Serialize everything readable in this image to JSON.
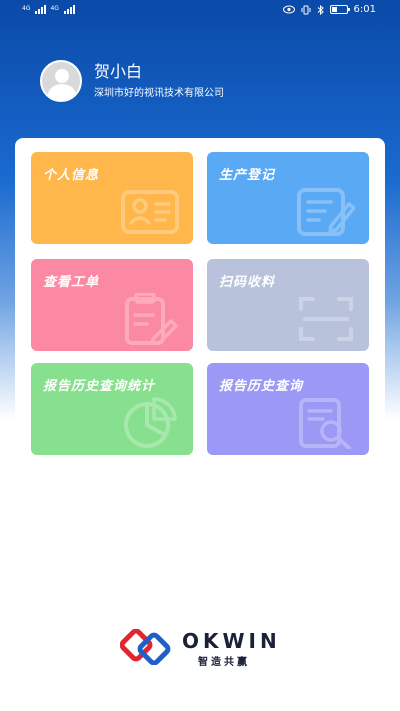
{
  "status_bar": {
    "sim1_label": "4G",
    "sim2_label": "4G",
    "time": "6:01",
    "battery_icon": "battery-icon",
    "eye_icon": "eye-icon",
    "vibrate_icon": "vibrate-icon",
    "bluetooth_icon": "bluetooth-icon"
  },
  "user": {
    "name": "贺小白",
    "company": "深圳市好的视讯技术有限公司",
    "avatar_icon": "avatar-icon"
  },
  "tiles": [
    {
      "label": "个人信息",
      "color": "#ffb64a",
      "icon": "id-card-icon"
    },
    {
      "label": "生产登记",
      "color": "#5aa9f5",
      "icon": "edit-form-icon"
    },
    {
      "label": "查看工单",
      "color": "#fb89a3",
      "icon": "clipboard-icon"
    },
    {
      "label": "扫码收料",
      "color": "#b8c2da",
      "icon": "scan-icon"
    },
    {
      "label": "报告历史查询统计",
      "color": "#86e08e",
      "icon": "pie-chart-icon"
    },
    {
      "label": "报告历史查询",
      "color": "#9b98f6",
      "icon": "search-document-icon"
    }
  ],
  "footer": {
    "brand": "OKWIN",
    "slogan": "智造共赢",
    "logo_colors": [
      "#e0262f",
      "#1e5fc8"
    ]
  }
}
